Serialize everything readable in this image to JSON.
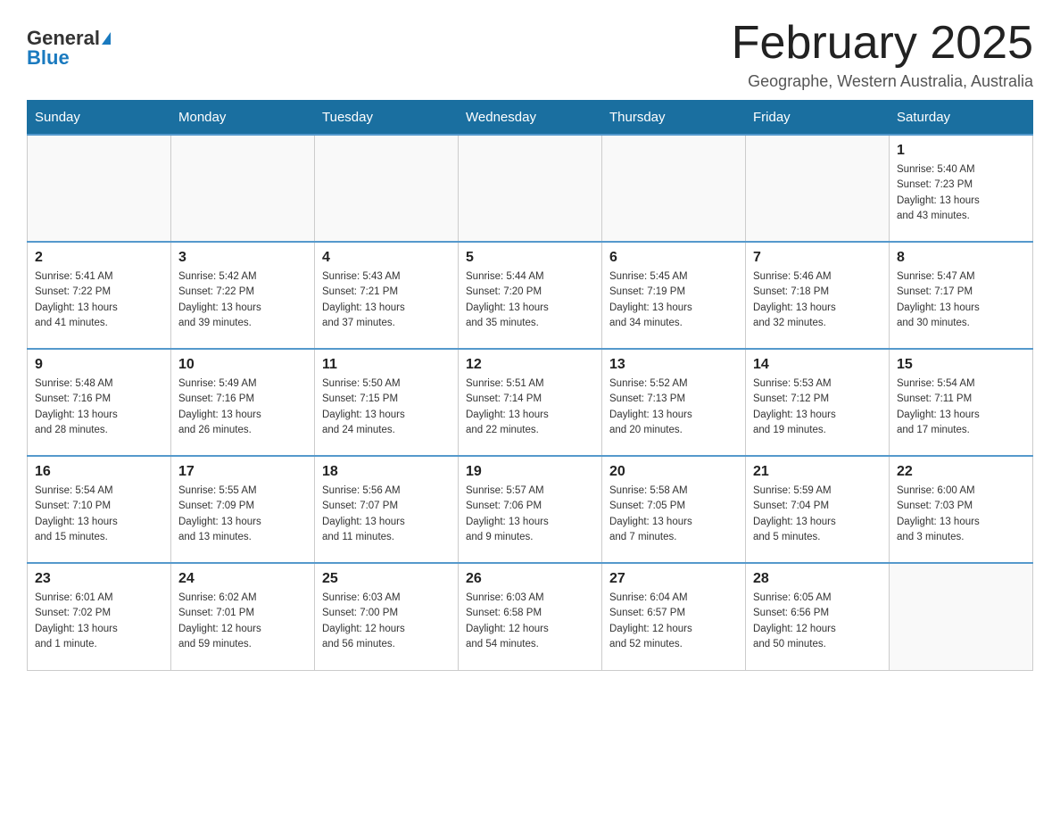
{
  "header": {
    "logo_general": "General",
    "logo_blue": "Blue",
    "month_title": "February 2025",
    "subtitle": "Geographe, Western Australia, Australia"
  },
  "days_of_week": [
    "Sunday",
    "Monday",
    "Tuesday",
    "Wednesday",
    "Thursday",
    "Friday",
    "Saturday"
  ],
  "weeks": [
    [
      {
        "day": "",
        "info": ""
      },
      {
        "day": "",
        "info": ""
      },
      {
        "day": "",
        "info": ""
      },
      {
        "day": "",
        "info": ""
      },
      {
        "day": "",
        "info": ""
      },
      {
        "day": "",
        "info": ""
      },
      {
        "day": "1",
        "info": "Sunrise: 5:40 AM\nSunset: 7:23 PM\nDaylight: 13 hours\nand 43 minutes."
      }
    ],
    [
      {
        "day": "2",
        "info": "Sunrise: 5:41 AM\nSunset: 7:22 PM\nDaylight: 13 hours\nand 41 minutes."
      },
      {
        "day": "3",
        "info": "Sunrise: 5:42 AM\nSunset: 7:22 PM\nDaylight: 13 hours\nand 39 minutes."
      },
      {
        "day": "4",
        "info": "Sunrise: 5:43 AM\nSunset: 7:21 PM\nDaylight: 13 hours\nand 37 minutes."
      },
      {
        "day": "5",
        "info": "Sunrise: 5:44 AM\nSunset: 7:20 PM\nDaylight: 13 hours\nand 35 minutes."
      },
      {
        "day": "6",
        "info": "Sunrise: 5:45 AM\nSunset: 7:19 PM\nDaylight: 13 hours\nand 34 minutes."
      },
      {
        "day": "7",
        "info": "Sunrise: 5:46 AM\nSunset: 7:18 PM\nDaylight: 13 hours\nand 32 minutes."
      },
      {
        "day": "8",
        "info": "Sunrise: 5:47 AM\nSunset: 7:17 PM\nDaylight: 13 hours\nand 30 minutes."
      }
    ],
    [
      {
        "day": "9",
        "info": "Sunrise: 5:48 AM\nSunset: 7:16 PM\nDaylight: 13 hours\nand 28 minutes."
      },
      {
        "day": "10",
        "info": "Sunrise: 5:49 AM\nSunset: 7:16 PM\nDaylight: 13 hours\nand 26 minutes."
      },
      {
        "day": "11",
        "info": "Sunrise: 5:50 AM\nSunset: 7:15 PM\nDaylight: 13 hours\nand 24 minutes."
      },
      {
        "day": "12",
        "info": "Sunrise: 5:51 AM\nSunset: 7:14 PM\nDaylight: 13 hours\nand 22 minutes."
      },
      {
        "day": "13",
        "info": "Sunrise: 5:52 AM\nSunset: 7:13 PM\nDaylight: 13 hours\nand 20 minutes."
      },
      {
        "day": "14",
        "info": "Sunrise: 5:53 AM\nSunset: 7:12 PM\nDaylight: 13 hours\nand 19 minutes."
      },
      {
        "day": "15",
        "info": "Sunrise: 5:54 AM\nSunset: 7:11 PM\nDaylight: 13 hours\nand 17 minutes."
      }
    ],
    [
      {
        "day": "16",
        "info": "Sunrise: 5:54 AM\nSunset: 7:10 PM\nDaylight: 13 hours\nand 15 minutes."
      },
      {
        "day": "17",
        "info": "Sunrise: 5:55 AM\nSunset: 7:09 PM\nDaylight: 13 hours\nand 13 minutes."
      },
      {
        "day": "18",
        "info": "Sunrise: 5:56 AM\nSunset: 7:07 PM\nDaylight: 13 hours\nand 11 minutes."
      },
      {
        "day": "19",
        "info": "Sunrise: 5:57 AM\nSunset: 7:06 PM\nDaylight: 13 hours\nand 9 minutes."
      },
      {
        "day": "20",
        "info": "Sunrise: 5:58 AM\nSunset: 7:05 PM\nDaylight: 13 hours\nand 7 minutes."
      },
      {
        "day": "21",
        "info": "Sunrise: 5:59 AM\nSunset: 7:04 PM\nDaylight: 13 hours\nand 5 minutes."
      },
      {
        "day": "22",
        "info": "Sunrise: 6:00 AM\nSunset: 7:03 PM\nDaylight: 13 hours\nand 3 minutes."
      }
    ],
    [
      {
        "day": "23",
        "info": "Sunrise: 6:01 AM\nSunset: 7:02 PM\nDaylight: 13 hours\nand 1 minute."
      },
      {
        "day": "24",
        "info": "Sunrise: 6:02 AM\nSunset: 7:01 PM\nDaylight: 12 hours\nand 59 minutes."
      },
      {
        "day": "25",
        "info": "Sunrise: 6:03 AM\nSunset: 7:00 PM\nDaylight: 12 hours\nand 56 minutes."
      },
      {
        "day": "26",
        "info": "Sunrise: 6:03 AM\nSunset: 6:58 PM\nDaylight: 12 hours\nand 54 minutes."
      },
      {
        "day": "27",
        "info": "Sunrise: 6:04 AM\nSunset: 6:57 PM\nDaylight: 12 hours\nand 52 minutes."
      },
      {
        "day": "28",
        "info": "Sunrise: 6:05 AM\nSunset: 6:56 PM\nDaylight: 12 hours\nand 50 minutes."
      },
      {
        "day": "",
        "info": ""
      }
    ]
  ]
}
